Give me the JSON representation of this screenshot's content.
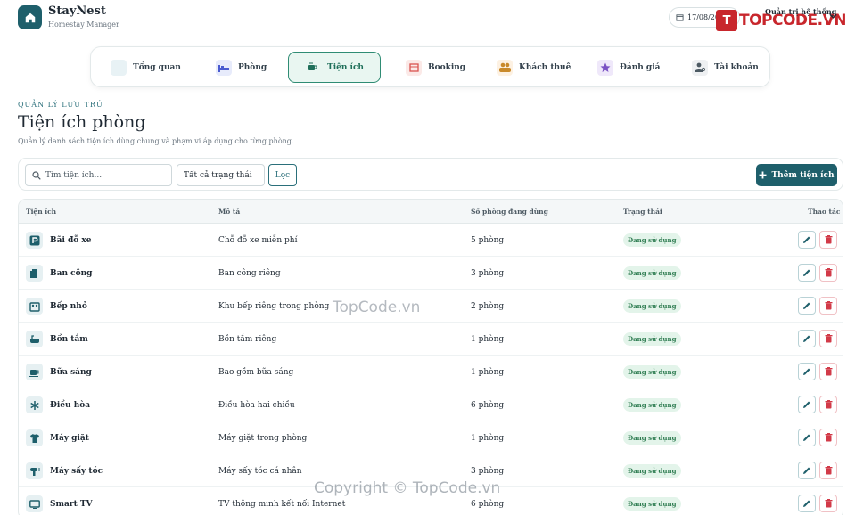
{
  "header": {
    "brand_name": "StayNest",
    "brand_sub": "Homestay Manager",
    "date": "17/08/20",
    "admin_label": "Quản trị hệ thống",
    "watermark_flag": "T",
    "watermark": "TOPCODE.VN"
  },
  "nav": {
    "items": [
      {
        "label": "Tổng quan",
        "icon": "grid-icon"
      },
      {
        "label": "Phòng",
        "icon": "bed-icon"
      },
      {
        "label": "Tiện ích",
        "icon": "coffee-icon",
        "active": true
      },
      {
        "label": "Booking",
        "icon": "calendar-icon"
      },
      {
        "label": "Khách thuê",
        "icon": "users-icon"
      },
      {
        "label": "Đánh giá",
        "icon": "star-icon"
      },
      {
        "label": "Tài khoản",
        "icon": "user-gear-icon"
      }
    ]
  },
  "page": {
    "eyebrow": "QUẢN LÝ LƯU TRÚ",
    "title": "Tiện ích phòng",
    "description": "Quản lý danh sách tiện ích dùng chung và phạm vi áp dụng cho từng phòng."
  },
  "filters": {
    "search_placeholder": "Tìm tiện ích...",
    "status_value": "Tất cả trạng thái",
    "filter_button": "Lọc",
    "add_button": "Thêm tiện ích"
  },
  "table": {
    "columns": [
      "Tiện ích",
      "Mô tả",
      "Số phòng đang dùng",
      "Trạng thái",
      "Thao tác"
    ],
    "rows": [
      {
        "name": "Bãi đỗ xe",
        "desc": "Chỗ đỗ xe miễn phí",
        "count": "5 phòng",
        "status": "Đang sử dụng",
        "icon": "parking-icon"
      },
      {
        "name": "Ban công",
        "desc": "Ban công riêng",
        "count": "3 phòng",
        "status": "Đang sử dụng",
        "icon": "door-icon"
      },
      {
        "name": "Bếp nhỏ",
        "desc": "Khu bếp riêng trong phòng",
        "count": "2 phòng",
        "status": "Đang sử dụng",
        "icon": "stove-icon"
      },
      {
        "name": "Bồn tắm",
        "desc": "Bồn tắm riêng",
        "count": "1 phòng",
        "status": "Đang sử dụng",
        "icon": "bath-icon"
      },
      {
        "name": "Bữa sáng",
        "desc": "Bao gồm bữa sáng",
        "count": "1 phòng",
        "status": "Đang sử dụng",
        "icon": "coffee-cup-icon"
      },
      {
        "name": "Điều hòa",
        "desc": "Điều hòa hai chiều",
        "count": "6 phòng",
        "status": "Đang sử dụng",
        "icon": "snowflake-icon"
      },
      {
        "name": "Máy giặt",
        "desc": "Máy giặt trong phòng",
        "count": "1 phòng",
        "status": "Đang sử dụng",
        "icon": "shirt-icon"
      },
      {
        "name": "Máy sấy tóc",
        "desc": "Máy sấy tóc cá nhân",
        "count": "3 phòng",
        "status": "Đang sử dụng",
        "icon": "hair-dryer-icon"
      },
      {
        "name": "Smart TV",
        "desc": "TV thông minh kết nối Internet",
        "count": "6 phòng",
        "status": "Đang sử dụng",
        "icon": "tv-icon"
      }
    ]
  },
  "watermarks": {
    "center": "TopCode.vn",
    "bottom": "Copyright © TopCode.vn"
  },
  "colors": {
    "primary": "#1e5f6b",
    "active_tab_bg": "#e9f6f1",
    "badge_bg": "#e3f4ea",
    "badge_text": "#2f7d52",
    "delete": "#d23a48"
  }
}
